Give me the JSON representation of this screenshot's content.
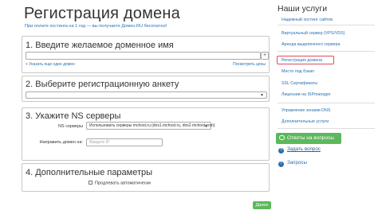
{
  "main": {
    "title": "Регистрация домена",
    "promo": "При оплате хостинга на 1 год — вы получаете Домен.RU бесплатно!",
    "sections": {
      "s1": {
        "title": "1. Введите желаемое доменное имя",
        "add_icon": "plus-icon",
        "link_left": "+ Указать еще один домен",
        "link_right": "Посмотреть цены"
      },
      "s2": {
        "title": "2. Выберите регистрационную анкету",
        "selected_value": ""
      },
      "s3": {
        "title": "3. Укажите NS серверы",
        "ns_label": "NS серверы",
        "ns_selected": "Использовать серверы mchost.ru (dns1.mchost.ru, dns2.mchost.com)",
        "domain_label": "Направить домен на:",
        "domain_placeholder": "Введите IP"
      },
      "s4": {
        "title": "4. Дополнительные параметры",
        "checkbox_label": "Продлевать автоматически"
      }
    },
    "next_button": "Далее"
  },
  "sidebar": {
    "title": "Наши услуги",
    "items": [
      {
        "label": "Надежный хостинг сайтов"
      },
      {
        "label": "Виртуальный сервер (VPS/VDS)"
      },
      {
        "label": "Аренда выделенного сервера"
      },
      {
        "label": "Регистрация домена",
        "active": true
      },
      {
        "label": "Место под бэкап"
      },
      {
        "label": "SSL Сертификаты"
      },
      {
        "label": "Лицензии на ISPmanager"
      },
      {
        "label": "Управление зонами DNS"
      },
      {
        "label": "Дополнительные услуги"
      }
    ],
    "questions_button": "Ответы на вопросы",
    "ask_link": "Задать вопрос",
    "requests_link": "Запросы"
  },
  "colors": {
    "link": "#2a6fb0",
    "accent_green": "#5cb85c",
    "active_border": "#e04a5f"
  }
}
